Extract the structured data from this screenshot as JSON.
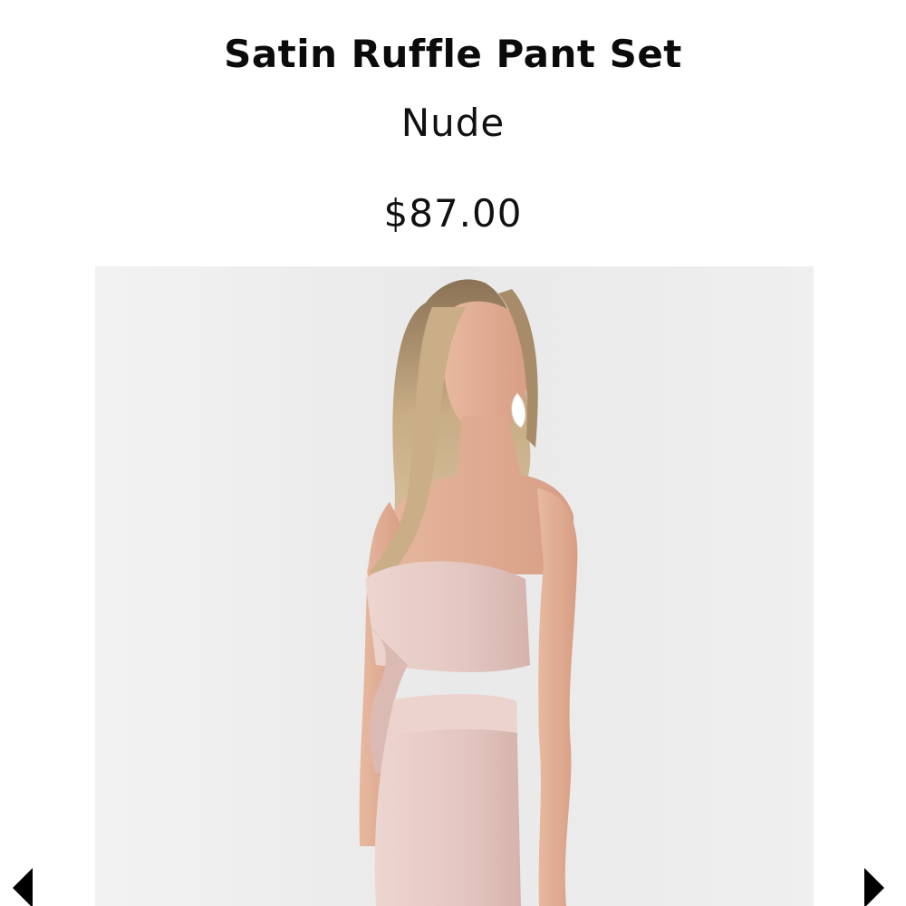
{
  "product": {
    "title": "Satin Ruffle Pant Set",
    "color": "Nude",
    "price": "$87.00"
  },
  "gallery": {
    "image_subject": "model-wearing-nude-strapless-tie-top-and-high-waist-pants",
    "prev_icon": "triangle-left",
    "next_icon": "triangle-right"
  },
  "colors": {
    "text": "#111111",
    "photo_background": "#eeeeee",
    "garment": "#e8cdc8",
    "arrow": "#000000"
  }
}
